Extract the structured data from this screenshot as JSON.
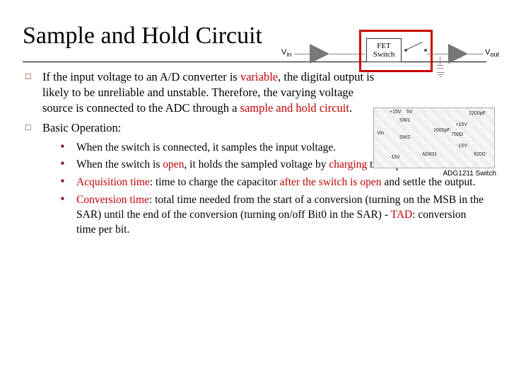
{
  "title": "Sample and Hold Circuit",
  "points": {
    "p1_pre": "If the input voltage to an A/D converter is ",
    "p1_var": "variable",
    "p1_mid": ", the digital output is likely to be unreliable and unstable. Therefore, the varying voltage source is connected to the ADC through a ",
    "p1_sh": "sample and hold circuit",
    "p1_end": ".",
    "p2": "Basic Operation:",
    "sub1": "When the switch is connected, it samples the input voltage.",
    "sub2_pre": "When the switch is ",
    "sub2_open": "open",
    "sub2_mid": ", it holds the sampled voltage by ",
    "sub2_chg": "charging",
    "sub2_end": " the capacitor.",
    "sub3_at": "Acquisition time",
    "sub3_mid1": ": time to charge the capacitor ",
    "sub3_aft": "after the switch is open",
    "sub3_end": " and settle the output.",
    "sub4_ct": "Conversion time",
    "sub4_body": ": total time needed from the start of a conversion (turning on  the MSB in the SAR) until the end of the conversion (turning on/off Bit0 in the SAR)",
    "sub4_tad_dash": " - ",
    "sub4_tad": "TAD",
    "sub4_tad_end": ": conversion time per bit."
  },
  "diagram": {
    "vin": "V",
    "in_sub": "in",
    "vout": "V",
    "out_sub": "out",
    "fet1": "FET",
    "fet2": "Switch"
  },
  "diagram2": {
    "caption": "ADG1211 Switch",
    "p15": "+15V",
    "m15": "-15V",
    "sv": "5V",
    "vin": "Vin",
    "cap1": "2200pF",
    "cap2": "1000pF",
    "r1": "750Ω",
    "r2": "620Ω",
    "sw1": "SW1",
    "sw2": "SW2",
    "adc": "AD831"
  }
}
